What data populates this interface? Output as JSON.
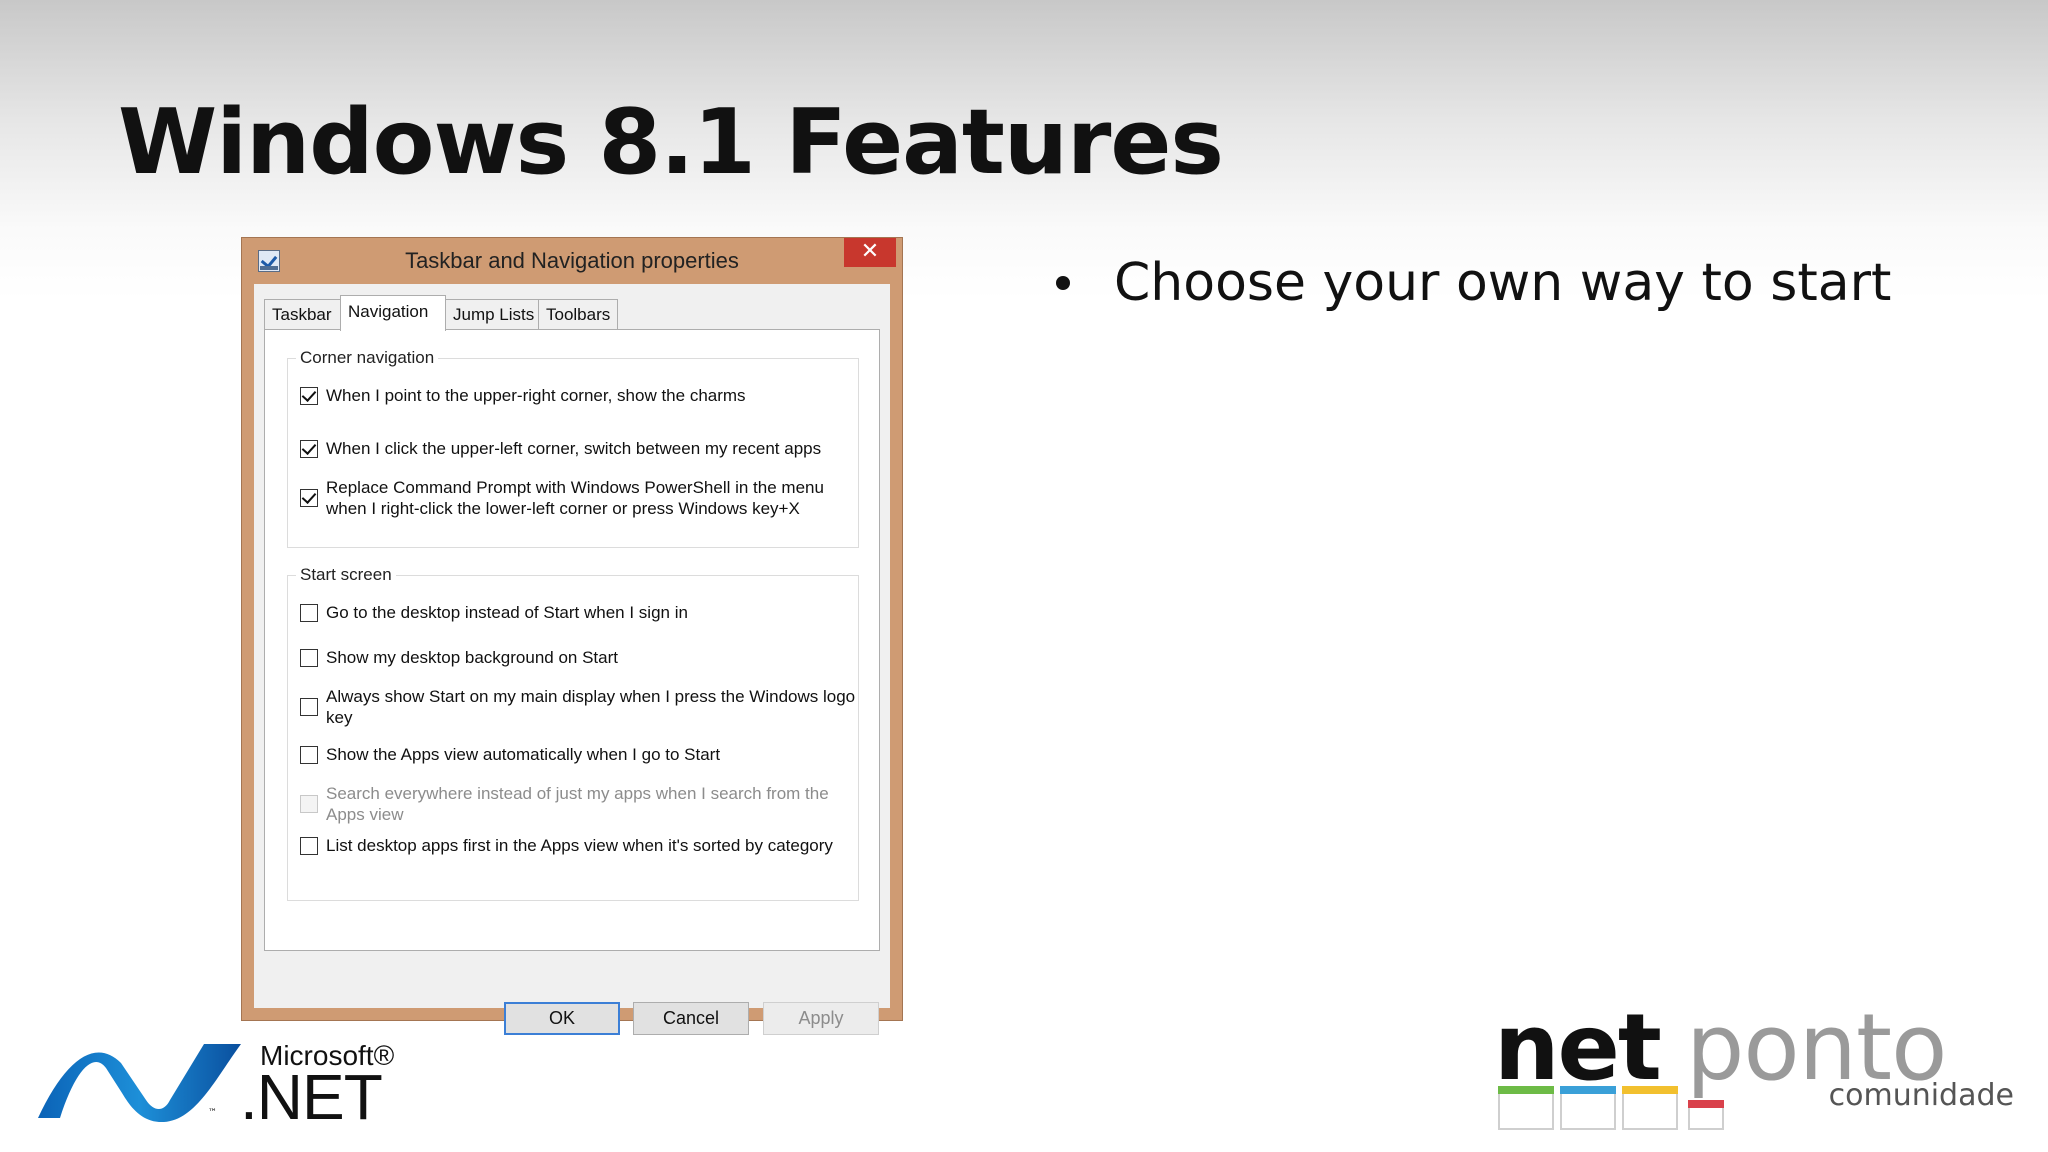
{
  "slide": {
    "title": "Windows 8.1 Features",
    "bullets": [
      "Choose your own way to start"
    ]
  },
  "dialog": {
    "title": "Taskbar and Navigation properties",
    "close_label": "✕",
    "tabs": [
      {
        "label": "Taskbar",
        "active": false
      },
      {
        "label": "Navigation",
        "active": true
      },
      {
        "label": "Jump Lists",
        "active": false
      },
      {
        "label": "Toolbars",
        "active": false
      }
    ],
    "corner_navigation": {
      "label": "Corner navigation",
      "options": [
        {
          "text": "When I point to the upper-right corner, show the charms",
          "checked": true,
          "enabled": true
        },
        {
          "text": "When I click the upper-left corner, switch between my recent apps",
          "checked": true,
          "enabled": true
        },
        {
          "text": "Replace Command Prompt with Windows PowerShell in the menu when I right-click the lower-left corner or press Windows key+X",
          "checked": true,
          "enabled": true
        }
      ]
    },
    "start_screen": {
      "label": "Start screen",
      "options": [
        {
          "text": "Go to the desktop instead of Start when I sign in",
          "checked": false,
          "enabled": true
        },
        {
          "text": "Show my desktop background on Start",
          "checked": false,
          "enabled": true
        },
        {
          "text": "Always show Start on my main display when I press the Windows logo key",
          "checked": false,
          "enabled": true
        },
        {
          "text": "Show the Apps view automatically when I go to Start",
          "checked": false,
          "enabled": true
        },
        {
          "text": "Search everywhere instead of just my apps when I search from the Apps view",
          "checked": false,
          "enabled": false
        },
        {
          "text": "List desktop apps first in the Apps view when it's sorted by category",
          "checked": false,
          "enabled": true
        }
      ]
    },
    "buttons": {
      "ok": "OK",
      "cancel": "Cancel",
      "apply": "Apply"
    }
  },
  "logos": {
    "ms_microsoft": "Microsoft®",
    "ms_net": ".NET",
    "ms_tm": "™",
    "np_net": "net",
    "np_ponto": "ponto",
    "np_comunidade": "comunidade"
  },
  "colors": {
    "dialog_frame": "#cf9b73",
    "close_button": "#c8372d",
    "default_button_border": "#3c7fd6",
    "netponto_green": "#6dbb46",
    "netponto_blue": "#3aa0d8",
    "netponto_yellow": "#f2c02e",
    "netponto_red": "#d9414b"
  }
}
